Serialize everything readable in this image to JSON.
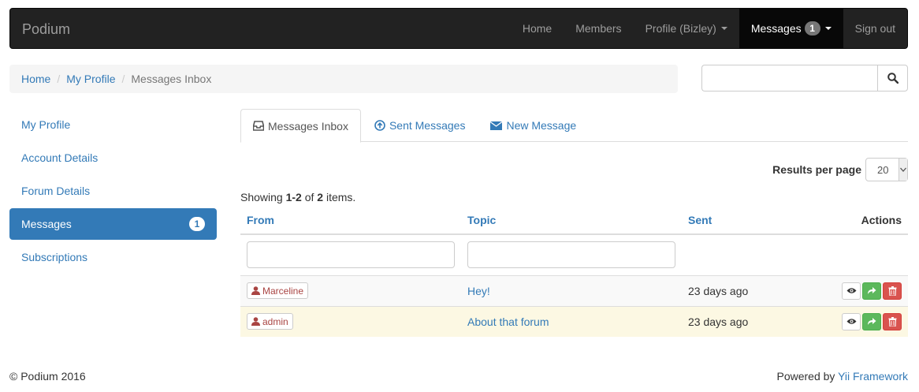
{
  "navbar": {
    "brand": "Podium",
    "items": [
      {
        "label": "Home"
      },
      {
        "label": "Members"
      },
      {
        "label": "Profile (Bizley)"
      },
      {
        "label": "Messages",
        "badge": "1"
      },
      {
        "label": "Sign out"
      }
    ]
  },
  "breadcrumb": {
    "items": [
      "Home",
      "My Profile",
      "Messages Inbox"
    ]
  },
  "search": {
    "placeholder": "",
    "icon": "search-icon"
  },
  "sidebar": {
    "items": [
      {
        "label": "My Profile"
      },
      {
        "label": "Account Details"
      },
      {
        "label": "Forum Details"
      },
      {
        "label": "Messages",
        "badge": "1"
      },
      {
        "label": "Subscriptions"
      }
    ]
  },
  "tabs": [
    {
      "label": "Messages Inbox",
      "icon": "inbox-icon"
    },
    {
      "label": "Sent Messages",
      "icon": "upload-circle-icon"
    },
    {
      "label": "New Message",
      "icon": "envelope-icon"
    }
  ],
  "results_per_page": {
    "label": "Results per page",
    "value": "20"
  },
  "summary": {
    "prefix": "Showing ",
    "range": "1-2",
    "of": " of ",
    "total": "2",
    "suffix": " items."
  },
  "table": {
    "headers": {
      "from": "From",
      "topic": "Topic",
      "sent": "Sent",
      "actions": "Actions"
    },
    "rows": [
      {
        "from": "Marceline",
        "topic": "Hey!",
        "sent": "23 days ago"
      },
      {
        "from": "admin",
        "topic": "About that forum",
        "sent": "23 days ago"
      }
    ]
  },
  "footer": {
    "copyright": "© Podium 2016",
    "powered_prefix": "Powered by ",
    "powered_link": "Yii Framework"
  },
  "colors": {
    "navbar_bg": "#222222",
    "accent": "#337ab7",
    "success": "#5cb85c",
    "danger": "#d9534f",
    "warning_row": "#fcf8e3"
  }
}
